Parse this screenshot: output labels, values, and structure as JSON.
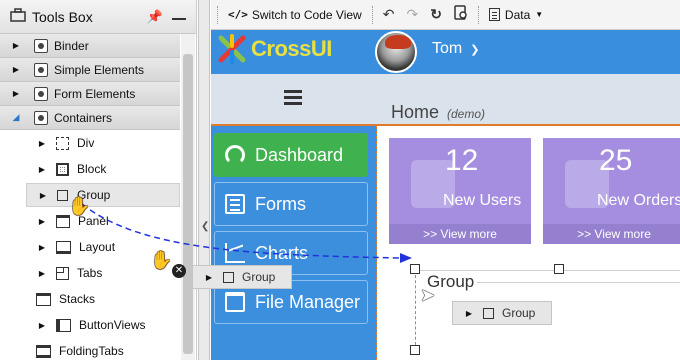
{
  "toolsbox": {
    "title": "Tools Box",
    "items": [
      {
        "label": "Binder"
      },
      {
        "label": "Simple Elements"
      },
      {
        "label": "Form Elements"
      },
      {
        "label": "Containers"
      },
      {
        "label": "Div"
      },
      {
        "label": "Block"
      },
      {
        "label": "Group"
      },
      {
        "label": "Panel"
      },
      {
        "label": "Layout"
      },
      {
        "label": "Tabs"
      },
      {
        "label": "Stacks"
      },
      {
        "label": "ButtonViews"
      },
      {
        "label": "FoldingTabs"
      }
    ]
  },
  "toolbar": {
    "switch_code": "Switch to Code View",
    "data_menu": "Data"
  },
  "app": {
    "logo": "CrossUI",
    "user": "Tom",
    "page_title": "Home",
    "page_sub": "(demo)",
    "nav": [
      {
        "label": "Dashboard"
      },
      {
        "label": "Forms"
      },
      {
        "label": "Charts"
      },
      {
        "label": "File Manager"
      }
    ],
    "tiles": [
      {
        "value": "12",
        "label": "New Users",
        "link": ">> View more"
      },
      {
        "value": "25",
        "label": "New Orders",
        "link": ">> View more"
      }
    ],
    "group_legend": "Group"
  },
  "drag": {
    "chip_label": "Group"
  },
  "colors": {
    "accent": "#3a8ede",
    "active_nav": "#3fb24f",
    "tile": "#a58ee0",
    "drag_arrow": "#2233dd"
  }
}
